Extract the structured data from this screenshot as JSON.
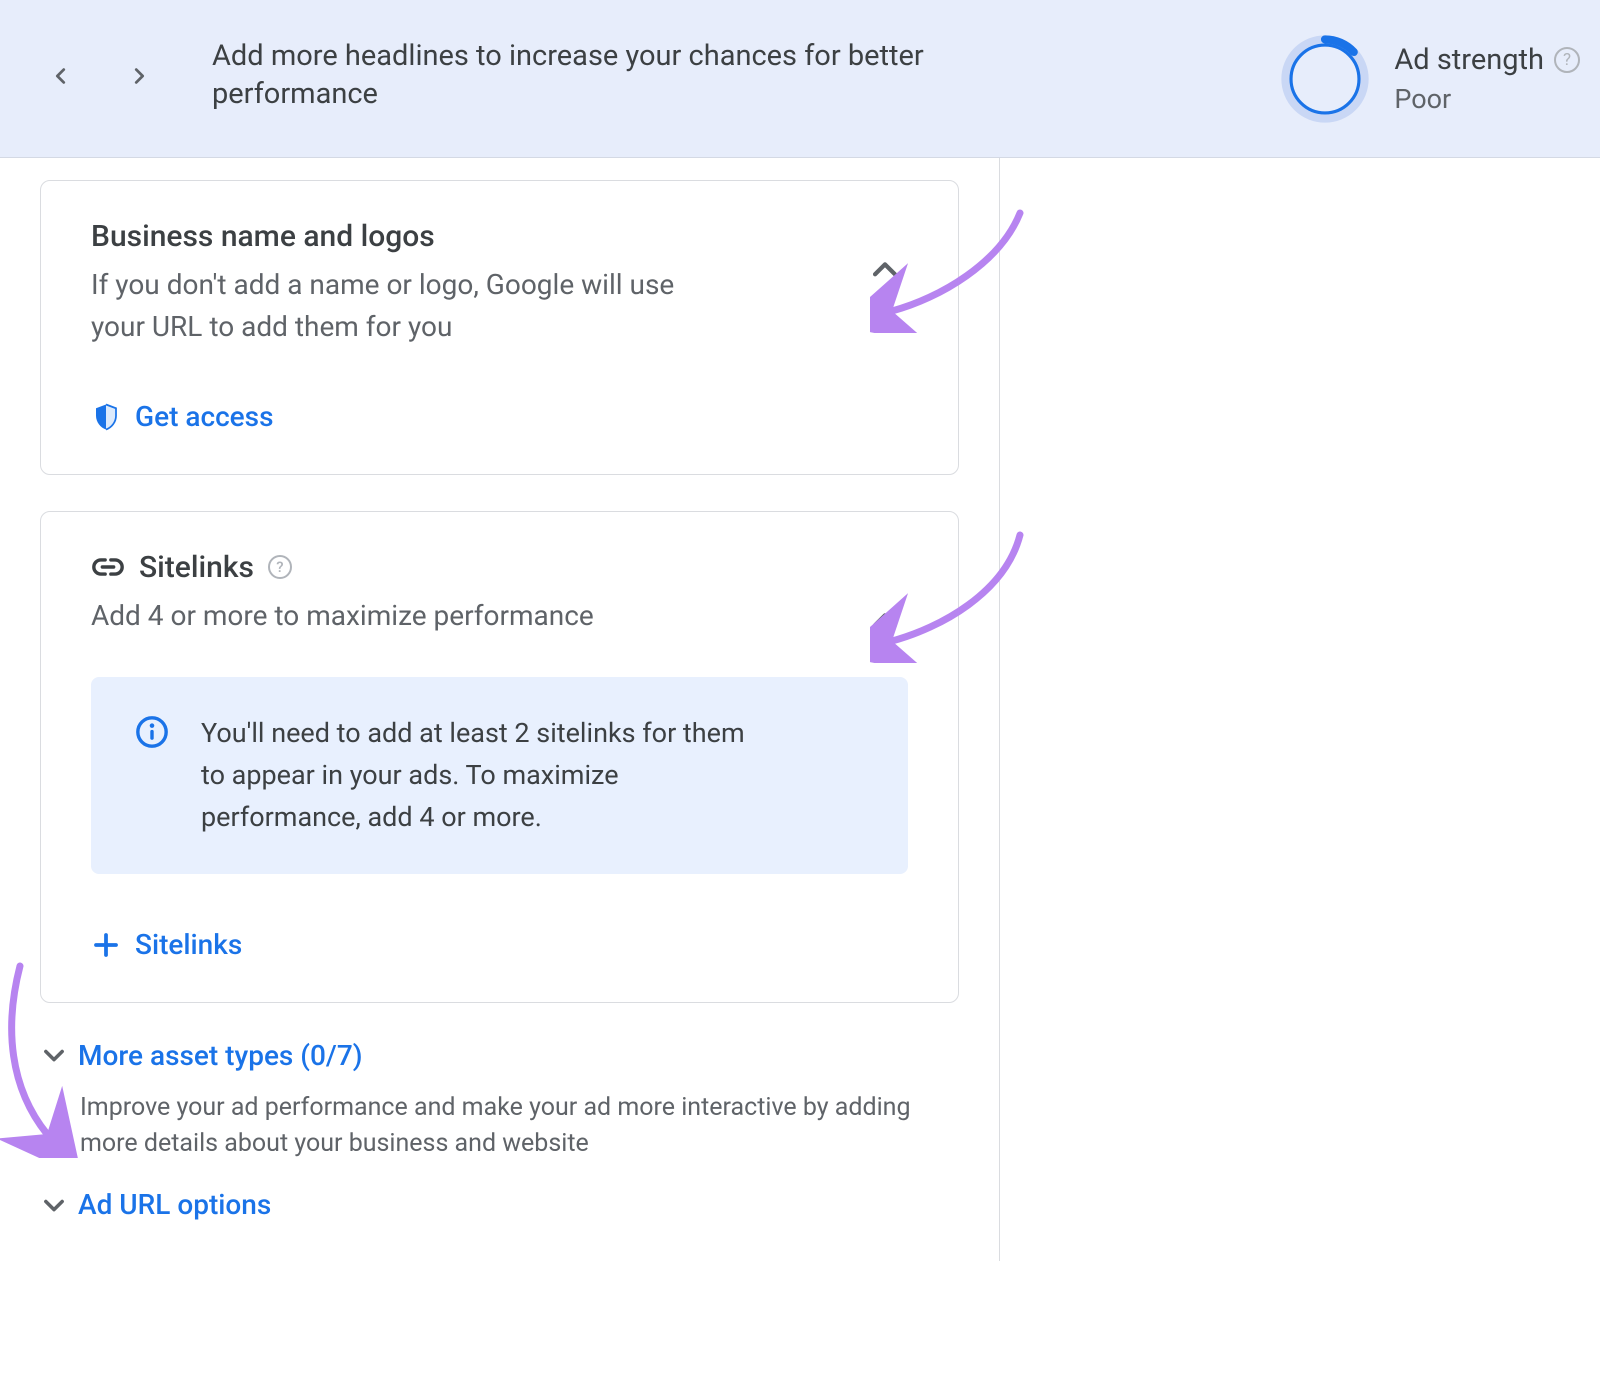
{
  "banner": {
    "message": "Add more headlines to increase your chances for better performance",
    "adstrength_label": "Ad strength",
    "adstrength_value": "Poor"
  },
  "card_business": {
    "title": "Business name and logos",
    "subtitle": "If you don't add a name or logo, Google will use your URL to add them for you",
    "action": "Get access"
  },
  "card_sitelinks": {
    "title": "Sitelinks",
    "subtitle": "Add 4 or more to maximize performance",
    "info": "You'll need to add at least 2 sitelinks for them to appear in your ads. To maximize performance, add 4 or more.",
    "add_label": "Sitelinks"
  },
  "more_assets": {
    "label": "More asset types (0/7)",
    "helper": "Improve your ad performance and make your ad more interactive by adding more details about your business and website"
  },
  "ad_url": {
    "label": "Ad URL options"
  }
}
